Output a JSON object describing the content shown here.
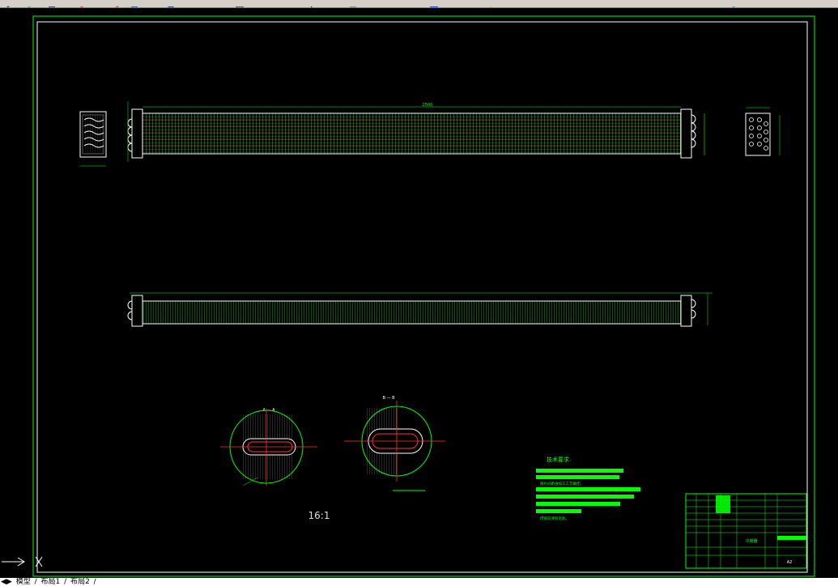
{
  "toolbar": {
    "icons": [
      "undo-icon",
      "redo-icon",
      "pan-icon",
      "zoom-icon",
      "layer-icon",
      "match-properties-icon",
      "properties-icon",
      "design-center-icon",
      "tool-palette-icon",
      "text-icon",
      "calculator-icon",
      "help-icon",
      "style-icon",
      "layer-state-icon"
    ]
  },
  "drawing": {
    "dim_length": "2500",
    "scale_label": "16:1",
    "section_a_label": "A — A",
    "section_b_label": "B — B",
    "tech_title": "技术要求:",
    "tech_req_1": "翅片间距由加工工艺确定。",
    "tech_req_2": "焊接前清除毛刺。",
    "title_block_name": "冷凝器",
    "sheet_label": "A2"
  },
  "layout_tabs": {
    "model": "模型",
    "layout1": "布局1",
    "layout2": "布局2"
  },
  "colors": {
    "green": "#00ff00",
    "red": "#ff0000",
    "white": "#ffffff",
    "yellow": "#ffff00"
  }
}
